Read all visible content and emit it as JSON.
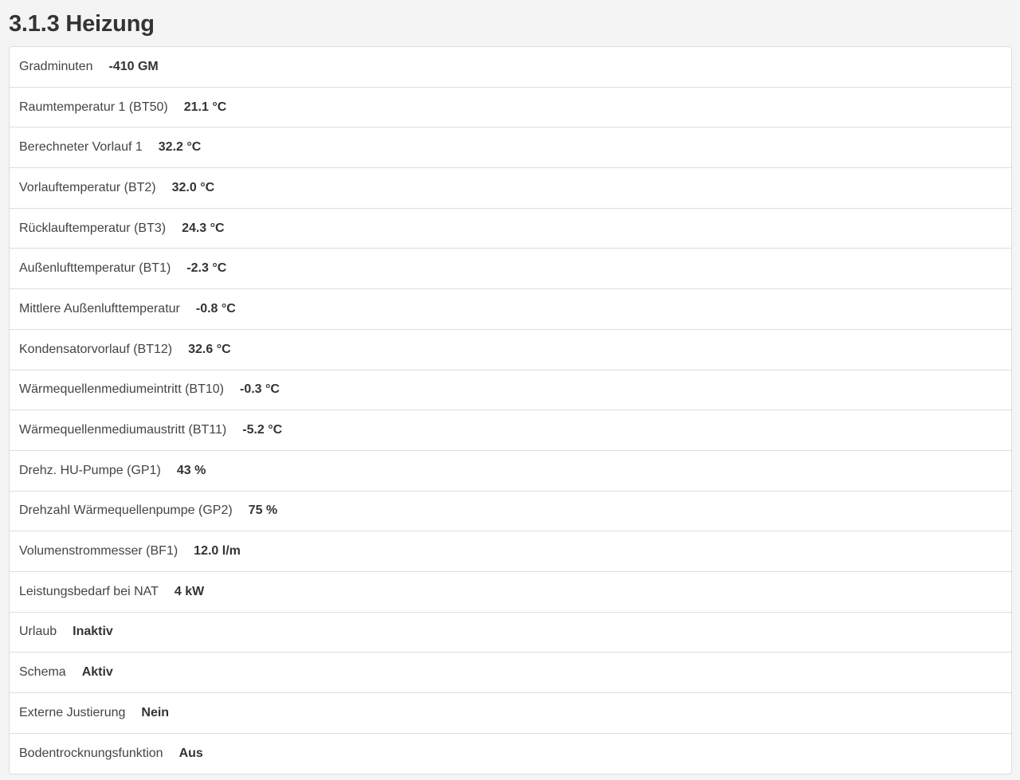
{
  "page": {
    "title": "3.1.3 Heizung"
  },
  "rows": [
    {
      "label": "Gradminuten",
      "value": "-410 GM"
    },
    {
      "label": "Raumtemperatur 1 (BT50)",
      "value": "21.1 °C"
    },
    {
      "label": "Berechneter Vorlauf 1",
      "value": "32.2 °C"
    },
    {
      "label": "Vorlauftemperatur (BT2)",
      "value": "32.0 °C"
    },
    {
      "label": "Rücklauftemperatur (BT3)",
      "value": "24.3 °C"
    },
    {
      "label": "Außenlufttemperatur (BT1)",
      "value": "-2.3 °C"
    },
    {
      "label": "Mittlere Außenlufttemperatur",
      "value": "-0.8 °C"
    },
    {
      "label": "Kondensatorvorlauf (BT12)",
      "value": "32.6 °C"
    },
    {
      "label": "Wärmequellenmediumeintritt (BT10)",
      "value": "-0.3 °C"
    },
    {
      "label": "Wärmequellenmediumaustritt (BT11)",
      "value": "-5.2 °C"
    },
    {
      "label": "Drehz. HU-Pumpe (GP1)",
      "value": "43 %"
    },
    {
      "label": "Drehzahl Wärmequellenpumpe (GP2)",
      "value": "75 %"
    },
    {
      "label": "Volumenstrommesser (BF1)",
      "value": "12.0 l/m"
    },
    {
      "label": "Leistungsbedarf bei NAT",
      "value": "4 kW"
    },
    {
      "label": "Urlaub",
      "value": "Inaktiv"
    },
    {
      "label": "Schema",
      "value": "Aktiv"
    },
    {
      "label": "Externe Justierung",
      "value": "Nein"
    },
    {
      "label": "Bodentrocknungsfunktion",
      "value": "Aus"
    }
  ]
}
